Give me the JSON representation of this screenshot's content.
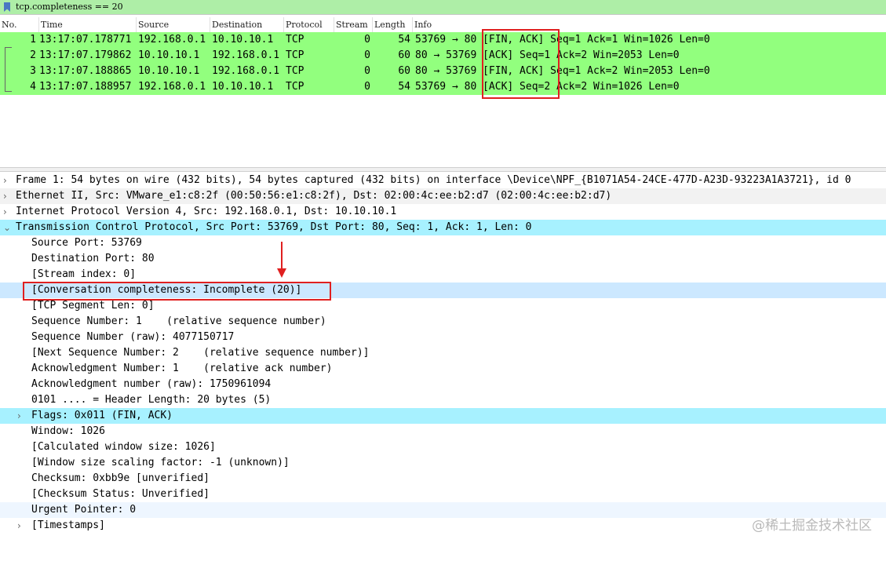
{
  "filter": {
    "expression": "tcp.completeness == 20"
  },
  "columns": [
    "No.",
    "Time",
    "Source",
    "Destination",
    "Protocol",
    "Stream",
    "Length",
    "Info"
  ],
  "packets": [
    {
      "no": "1",
      "time": "13:17:07.178771",
      "source": "192.168.0.1",
      "destination": "10.10.10.1",
      "protocol": "TCP",
      "stream": "0",
      "length": "54",
      "info": "53769 → 80 [FIN, ACK] Seq=1 Ack=1 Win=1026 Len=0"
    },
    {
      "no": "2",
      "time": "13:17:07.179862",
      "source": "10.10.10.1",
      "destination": "192.168.0.1",
      "protocol": "TCP",
      "stream": "0",
      "length": "60",
      "info": "80 → 53769 [ACK] Seq=1 Ack=2 Win=2053 Len=0"
    },
    {
      "no": "3",
      "time": "13:17:07.188865",
      "source": "10.10.10.1",
      "destination": "192.168.0.1",
      "protocol": "TCP",
      "stream": "0",
      "length": "60",
      "info": "80 → 53769 [FIN, ACK] Seq=1 Ack=2 Win=2053 Len=0"
    },
    {
      "no": "4",
      "time": "13:17:07.188957",
      "source": "192.168.0.1",
      "destination": "10.10.10.1",
      "protocol": "TCP",
      "stream": "0",
      "length": "54",
      "info": "53769 → 80 [ACK] Seq=2 Ack=2 Win=1026 Len=0"
    }
  ],
  "details": {
    "frame": "Frame 1: 54 bytes on wire (432 bits), 54 bytes captured (432 bits) on interface \\Device\\NPF_{B1071A54-24CE-477D-A23D-93223A1A3721}, id 0",
    "ethernet": "Ethernet II, Src: VMware_e1:c8:2f (00:50:56:e1:c8:2f), Dst: 02:00:4c:ee:b2:d7 (02:00:4c:ee:b2:d7)",
    "ip": "Internet Protocol Version 4, Src: 192.168.0.1, Dst: 10.10.10.1",
    "tcp": "Transmission Control Protocol, Src Port: 53769, Dst Port: 80, Seq: 1, Ack: 1, Len: 0",
    "tcp_fields": [
      "Source Port: 53769",
      "Destination Port: 80",
      "[Stream index: 0]",
      "[Conversation completeness: Incomplete (20)]",
      "[TCP Segment Len: 0]",
      "Sequence Number: 1    (relative sequence number)",
      "Sequence Number (raw): 4077150717",
      "[Next Sequence Number: 2    (relative sequence number)]",
      "Acknowledgment Number: 1    (relative ack number)",
      "Acknowledgment number (raw): 1750961094",
      "0101 .... = Header Length: 20 bytes (5)",
      "Flags: 0x011 (FIN, ACK)",
      "Window: 1026",
      "[Calculated window size: 1026]",
      "[Window size scaling factor: -1 (unknown)]",
      "Checksum: 0xbb9e [unverified]",
      "[Checksum Status: Unverified]",
      "Urgent Pointer: 0",
      "[Timestamps]"
    ]
  },
  "watermark": "@稀土掘金技术社区",
  "colors": {
    "tcp_row": "#92ff7e",
    "filter_ok": "#aeeea7",
    "highlight": "#a7f1ff",
    "annotation": "#e02020"
  }
}
